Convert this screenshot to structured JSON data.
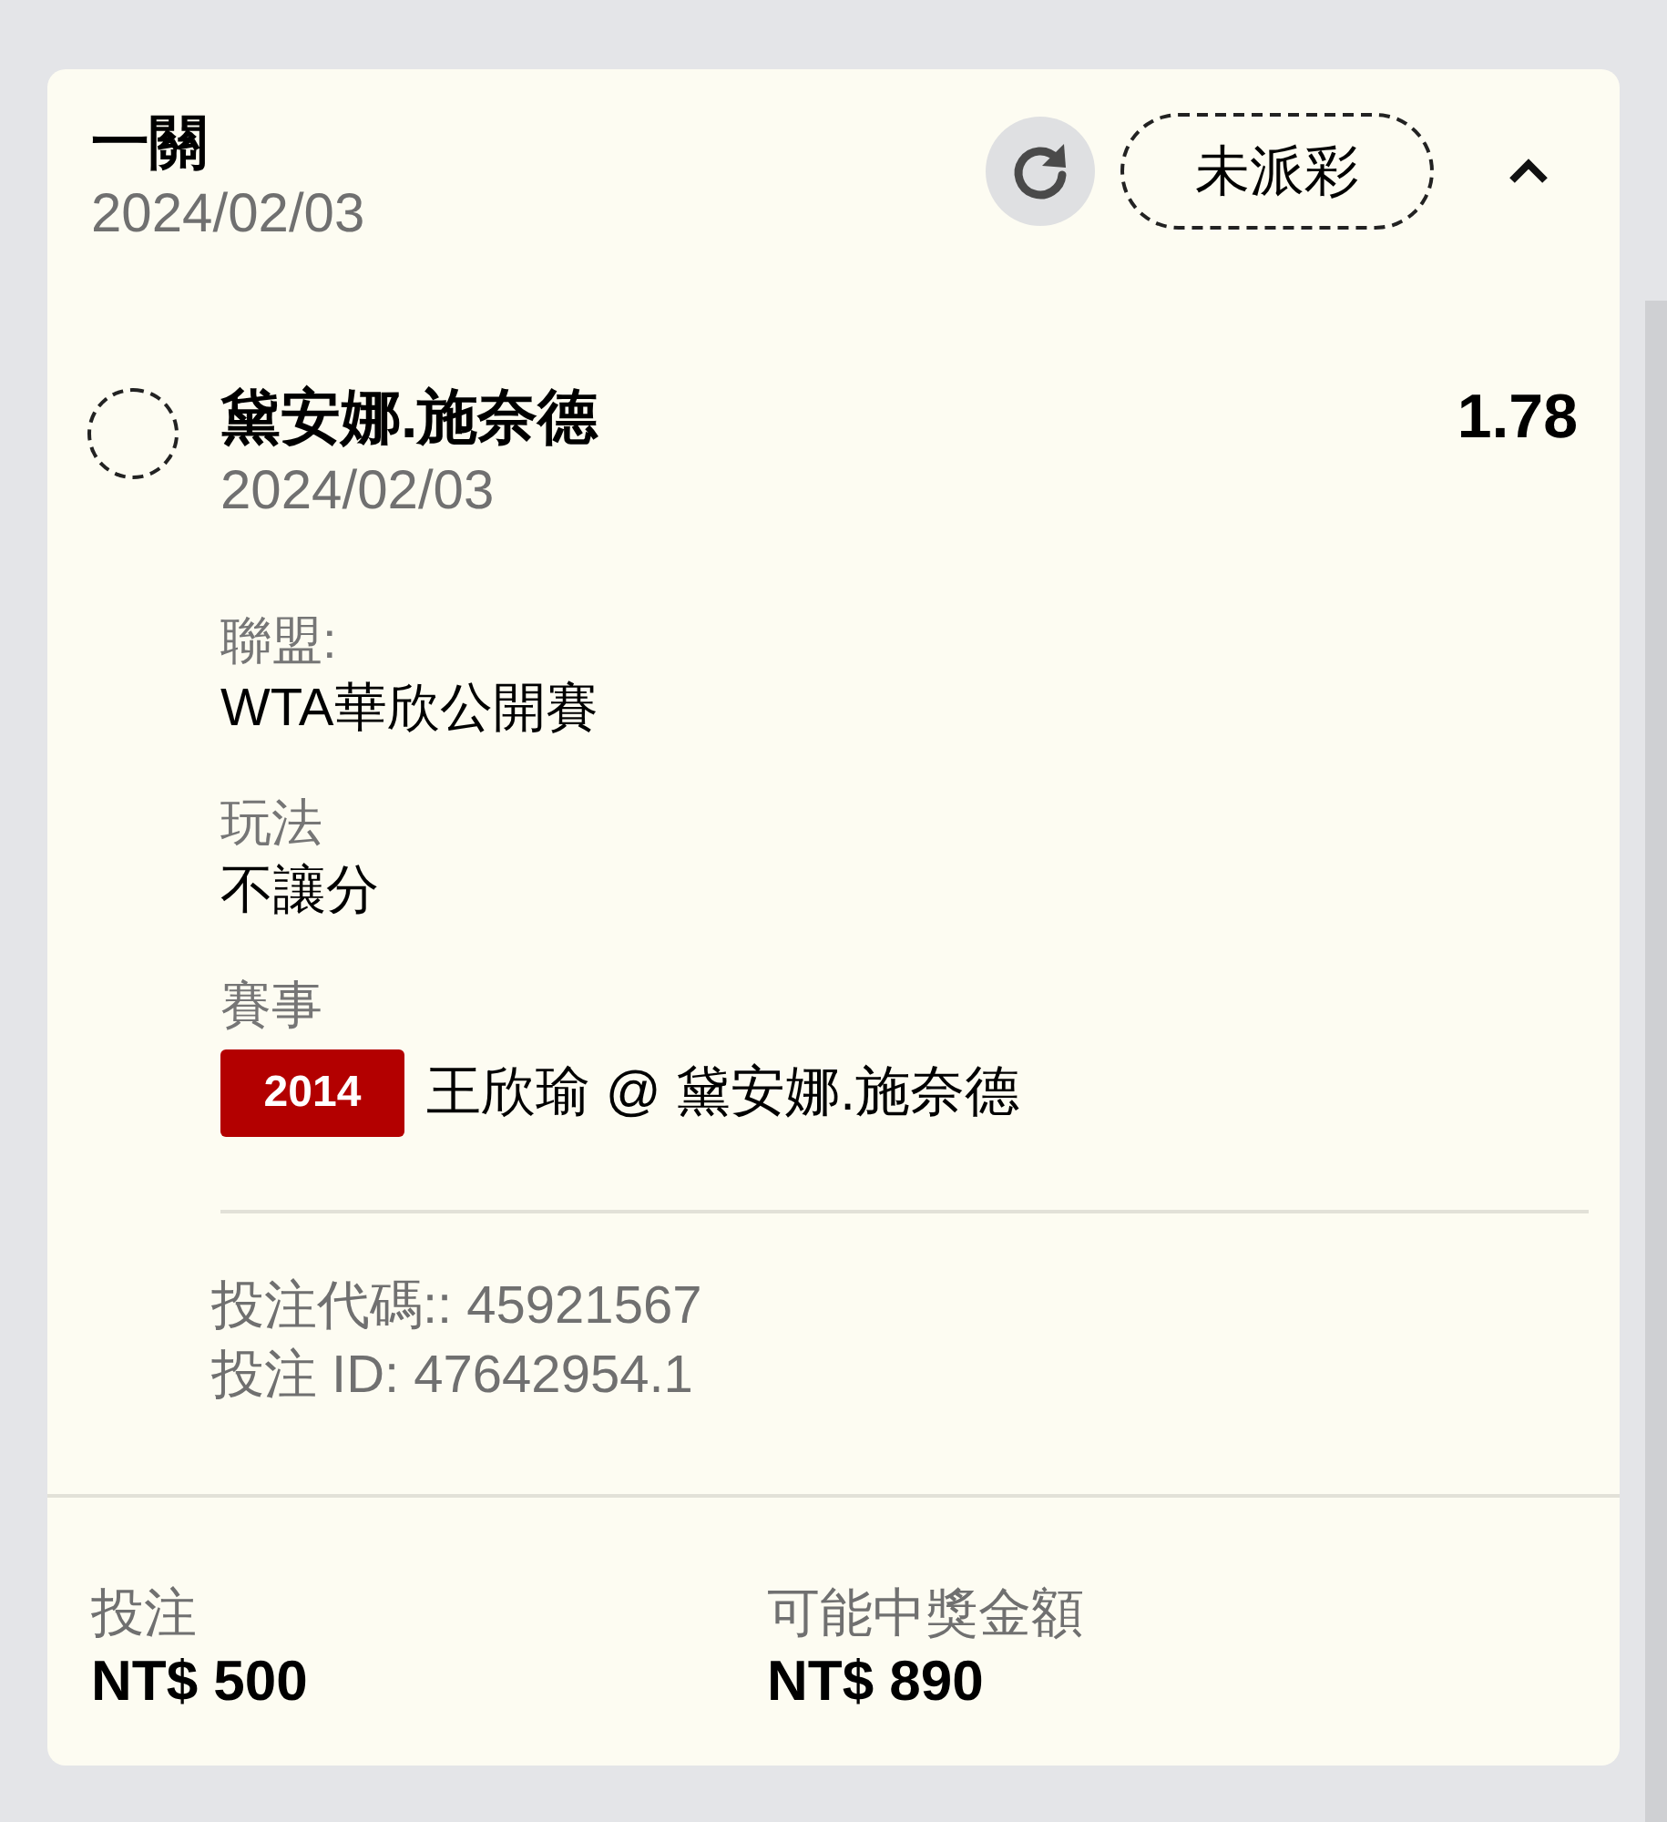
{
  "bet": {
    "title": "一關",
    "date": "2024/02/03",
    "status": "未派彩",
    "expanded": true
  },
  "selection": {
    "selected": false,
    "name": "黛安娜.施奈德",
    "odds": "1.78",
    "date": "2024/02/03",
    "details": [
      {
        "label": "聯盟:",
        "value": "WTA華欣公開賽"
      },
      {
        "label": "玩法",
        "value": "不讓分"
      }
    ],
    "event": {
      "label": "賽事",
      "code": "2014",
      "match": "王欣瑜 @ 黛安娜.施奈德"
    },
    "codes": [
      "投注代碼:: 45921567",
      "投注 ID: 47642954.1"
    ]
  },
  "summary": [
    {
      "label": "投注",
      "value": "NT$ 500"
    },
    {
      "label": "可能中獎金額",
      "value": "NT$ 890"
    }
  ]
}
